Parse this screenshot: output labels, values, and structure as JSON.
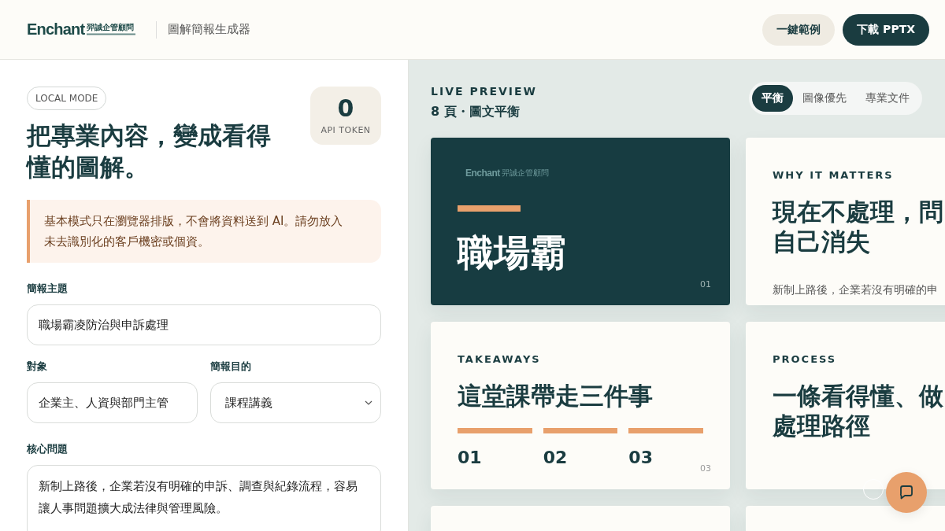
{
  "header": {
    "logo": {
      "wordmark": "Enchant",
      "chinese": "羿誠企管顧問"
    },
    "app_title": "圖解簡報生成器",
    "buttons": [
      {
        "label": "一鍵範例",
        "kind": "secondary"
      },
      {
        "label": "下載 PPTX",
        "kind": "primary"
      }
    ]
  },
  "form": {
    "mode_badge": "LOCAL MODE",
    "headline": "把專業內容，變成看得懂的圖解。",
    "token": {
      "value": "0",
      "label": "API TOKEN"
    },
    "notice": "基本模式只在瀏覽器排版，不會將資料送到 AI。請勿放入未去識別化的客戶機密或個資。",
    "topic": {
      "label": "簡報主題",
      "value": "職場霸凌防治與申訴處理"
    },
    "audience": {
      "label": "對象",
      "value": "企業主、人資與部門主管"
    },
    "purpose": {
      "label": "簡報目的",
      "value": "課程講義"
    },
    "core_issue": {
      "label": "核心問題",
      "value": "新制上路後，企業若沒有明確的申訴、調查與紀錄流程，容易讓人事問題擴大成法律與管理風險。"
    }
  },
  "preview": {
    "eyebrow": "LIVE PREVIEW",
    "summary": "8 頁・圖文平衡",
    "modes": [
      {
        "label": "平衡",
        "selected": true
      },
      {
        "label": "圖像優先",
        "selected": false
      },
      {
        "label": "專業文件",
        "selected": false
      }
    ],
    "slides": [
      {
        "kind": "cover",
        "logo_wordmark": "Enchant",
        "logo_chinese": "羿誠企管顧問",
        "title_lines": [
          "職場霸"
        ],
        "page": "01"
      },
      {
        "kind": "statement",
        "eyebrow": "WHY IT MATTERS",
        "title_lines": [
          "現在不處理，問",
          "自己消失"
        ],
        "body": "新制上路後，企業若沒有明確的申"
      },
      {
        "kind": "takeaways",
        "eyebrow": "TAKEAWAYS",
        "title_lines": [
          "這堂課帶走三件事"
        ],
        "items": [
          "01",
          "02",
          "03"
        ],
        "page": "03"
      },
      {
        "kind": "statement",
        "eyebrow": "PROCESS",
        "title_lines": [
          "一條看得懂、做",
          "處理路徑"
        ]
      },
      {
        "kind": "blank"
      },
      {
        "kind": "blank"
      }
    ]
  }
}
